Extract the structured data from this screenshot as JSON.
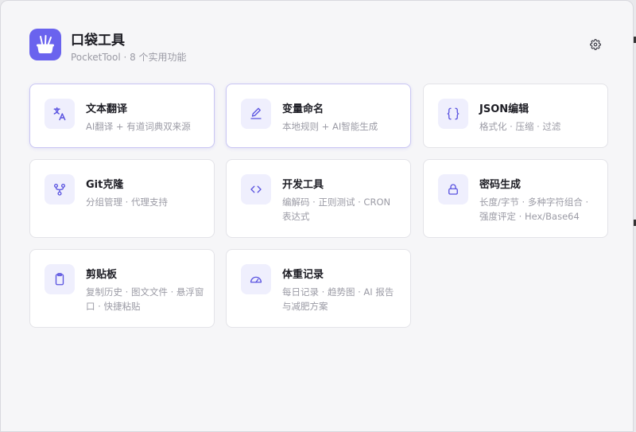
{
  "app": {
    "title": "口袋工具",
    "subtitle": "PocketTool · 8 个实用功能",
    "accent_color": "#6a63ee",
    "logo_icon": "pocket-tools-icon",
    "settings_icon": "gear-icon"
  },
  "tools": [
    {
      "name": "文本翻译",
      "desc": "AI翻译 + 有道词典双来源",
      "icon": "translate-icon"
    },
    {
      "name": "变量命名",
      "desc": "本地规则 + AI智能生成",
      "icon": "pencil-icon"
    },
    {
      "name": "JSON编辑",
      "desc": "格式化 · 压缩 · 过滤",
      "icon": "braces-icon"
    },
    {
      "name": "Git克隆",
      "desc": "分组管理 · 代理支持",
      "icon": "git-branch-icon"
    },
    {
      "name": "开发工具",
      "desc": "编解码 · 正则测试 · CRON 表达式",
      "icon": "code-icon"
    },
    {
      "name": "密码生成",
      "desc": "长度/字节 · 多种字符组合 · 强度评定 · Hex/Base64",
      "icon": "lock-icon"
    },
    {
      "name": "剪贴板",
      "desc": "复制历史 · 图文文件 · 悬浮窗口 · 快捷粘贴",
      "icon": "clipboard-icon"
    },
    {
      "name": "体重记录",
      "desc": "每日记录 · 趋势图 · AI 报告与减肥方案",
      "icon": "scale-icon"
    }
  ]
}
